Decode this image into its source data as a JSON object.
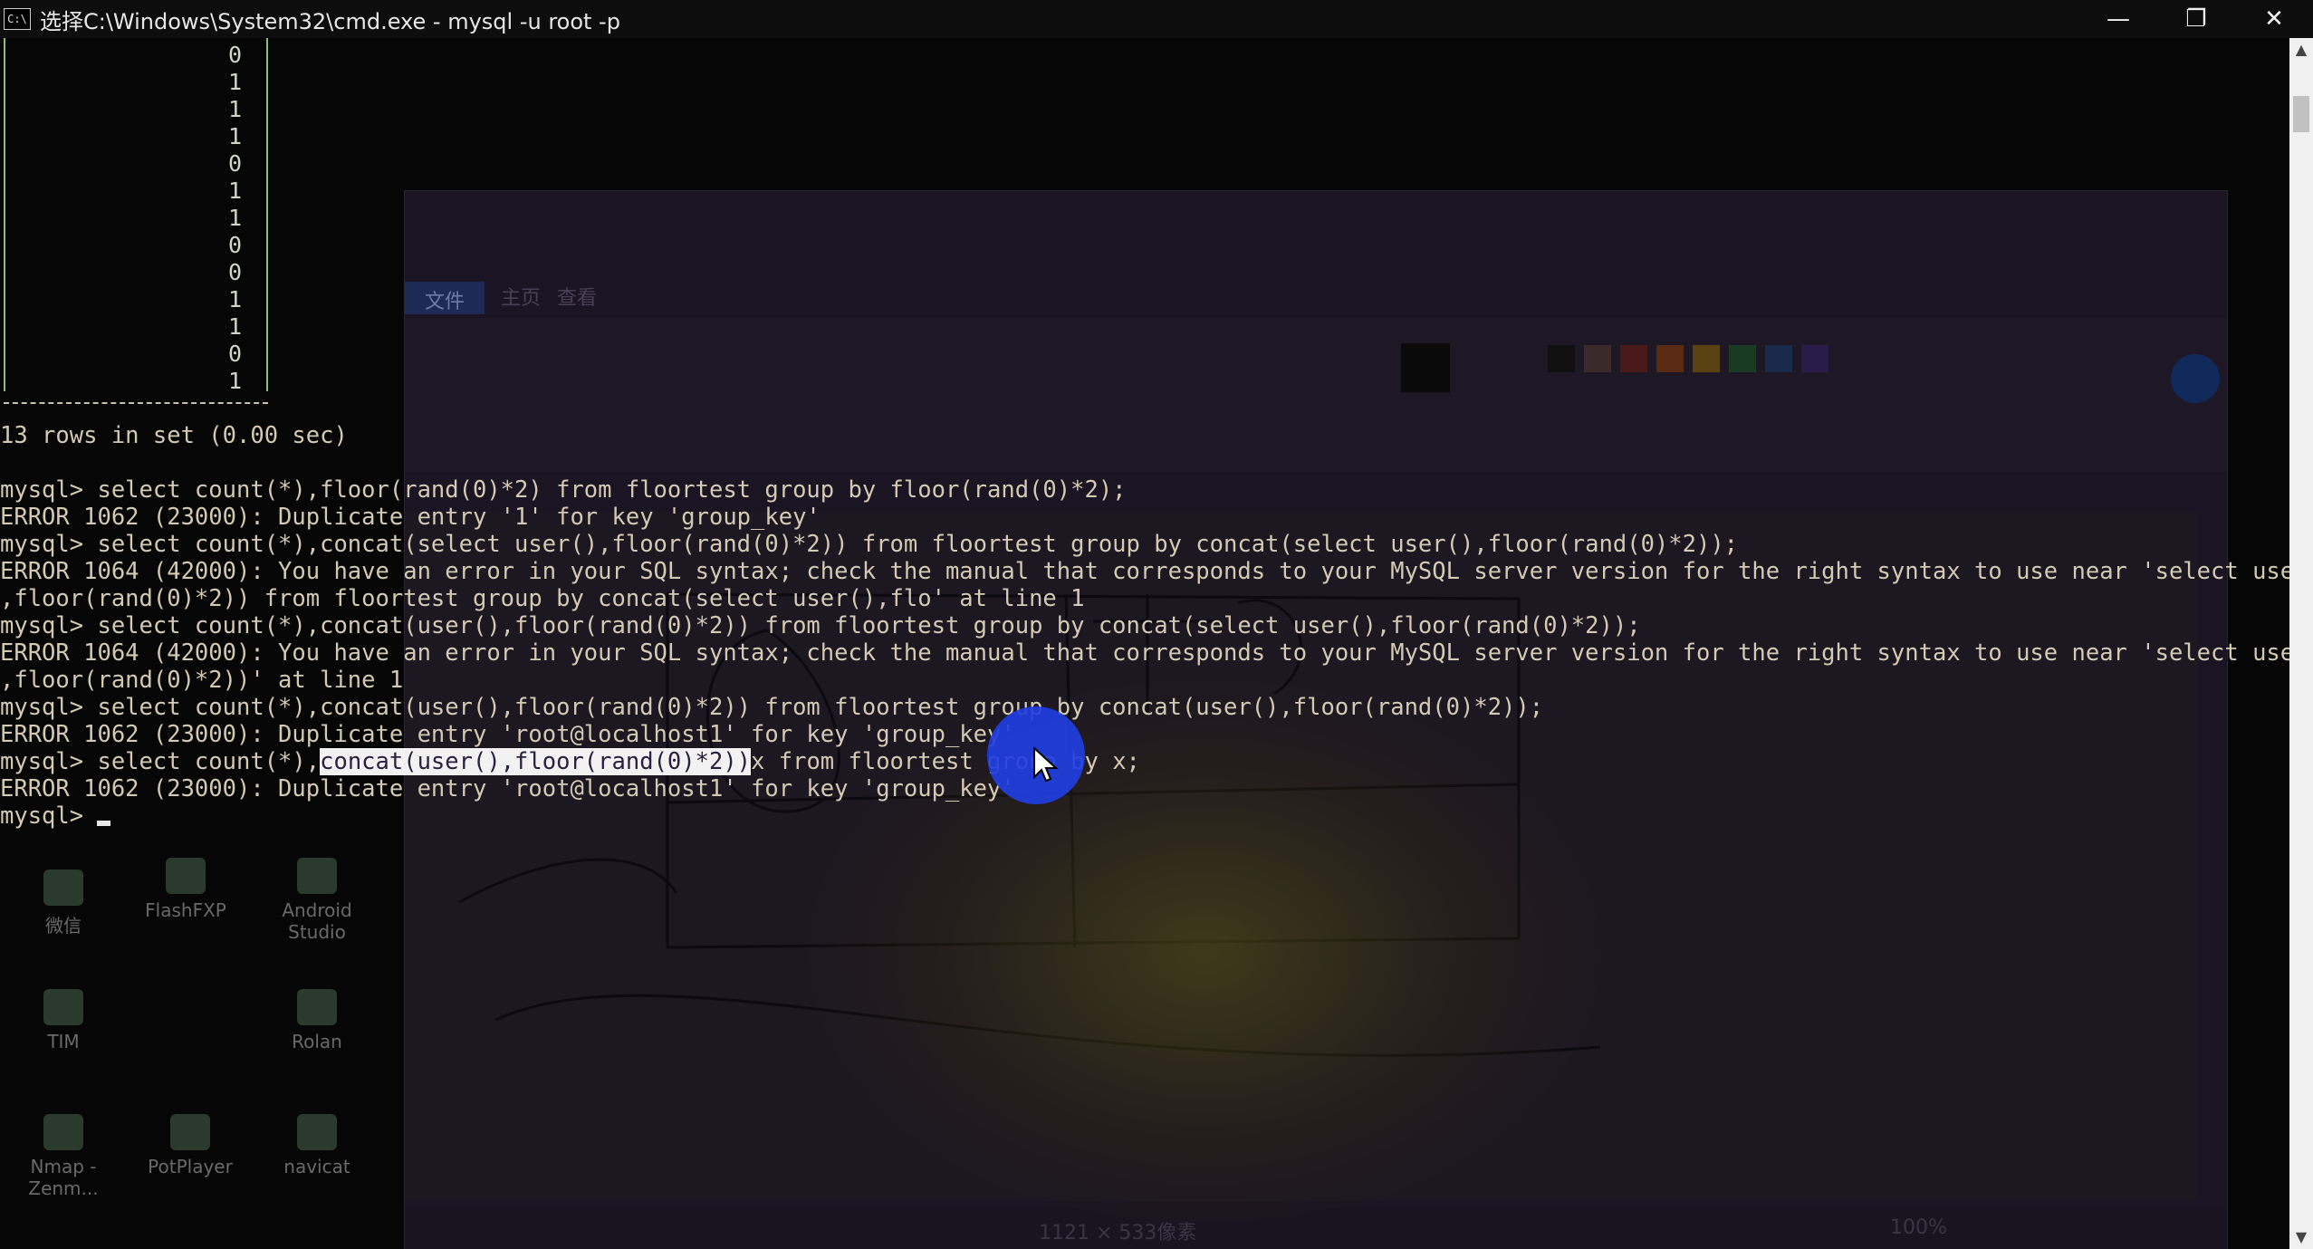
{
  "window": {
    "title": "选择C:\\Windows\\System32\\cmd.exe - mysql  -u root -p",
    "icon_label": "C:\\",
    "minimize_icon": "minimize-icon",
    "restore_icon": "restore-icon",
    "close_icon": "close-icon"
  },
  "table_column": {
    "values": [
      "0",
      "1",
      "1",
      "1",
      "0",
      "1",
      "1",
      "0",
      "0",
      "1",
      "1",
      "0",
      "1"
    ]
  },
  "console": {
    "rows_line": "13 rows in set (0.00 sec)",
    "lines": [
      "mysql> select count(*),floor(rand(0)*2) from floortest group by floor(rand(0)*2);",
      "ERROR 1062 (23000): Duplicate entry '1' for key 'group_key'",
      "mysql> select count(*),concat(select user(),floor(rand(0)*2)) from floortest group by concat(select user(),floor(rand(0)*2));",
      "ERROR 1064 (42000): You have an error in your SQL syntax; check the manual that corresponds to your MySQL server version for the right syntax to use near 'select user()",
      ",floor(rand(0)*2)) from floortest group by concat(select user(),flo' at line 1",
      "mysql> select count(*),concat(user(),floor(rand(0)*2)) from floortest group by concat(select user(),floor(rand(0)*2));",
      "ERROR 1064 (42000): You have an error in your SQL syntax; check the manual that corresponds to your MySQL server version for the right syntax to use near 'select user()",
      ",floor(rand(0)*2))' at line 1",
      "mysql> select count(*),concat(user(),floor(rand(0)*2)) from floortest group by concat(user(),floor(rand(0)*2));",
      "ERROR 1062 (23000): Duplicate entry 'root@localhost1' for key 'group_key'"
    ],
    "last_cmd_prefix": "mysql> select count(*),",
    "last_cmd_selected": "concat(user(),floor(rand(0)*2))",
    "last_cmd_suffix": "x from floortest group by x;",
    "last_error": "ERROR 1062 (23000): Duplicate entry 'root@localhost1' for key 'group_key'",
    "prompt": "mysql> "
  },
  "desktop_icons": [
    {
      "label": "FlashFXP"
    },
    {
      "label": "Android Studio"
    },
    {
      "label": "TIM"
    },
    {
      "label": "Rolan"
    },
    {
      "label": "Nmap - Zenm..."
    },
    {
      "label": "PotPlayer"
    },
    {
      "label": "navicat"
    },
    {
      "label": "微信"
    }
  ],
  "paint": {
    "tabs": [
      "文件",
      "主页",
      "查看"
    ],
    "status_size": "1121 × 533像素",
    "zoom": "100%"
  },
  "colors": {
    "console_bg": "#060606",
    "console_text": "#d4c9b2",
    "selection_bg": "#f2f2f2",
    "click_indicator": "#1f3ee0"
  }
}
